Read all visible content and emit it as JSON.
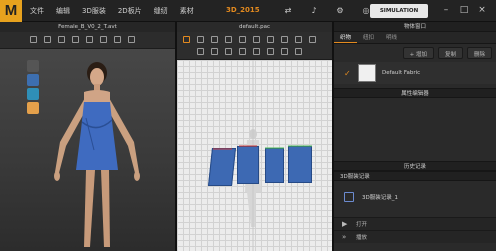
{
  "app": {
    "logo_letter": "M",
    "project_name": "3D_2015"
  },
  "menubar": {
    "items": [
      "文件",
      "编辑",
      "3D服装",
      "2D板片",
      "缝纫",
      "素材"
    ]
  },
  "toolbar_top": {
    "simulation_label": "SIMULATION",
    "icons": [
      "flip-icon",
      "speaker-icon",
      "gear-icon",
      "globe-icon",
      "help-icon"
    ]
  },
  "view3d": {
    "title": "Female_B_V0_2_T.avt",
    "side_buttons": [
      "t-shirt-icon",
      "fabric-icon",
      "pattern-icon",
      "avatar-icon"
    ]
  },
  "view2d": {
    "title": "default.pac"
  },
  "right_panel": {
    "title": "物体窗口",
    "tabs": [
      "织物",
      "纽扣",
      "明线"
    ],
    "add_label": "+ 增加",
    "copy_label": "复制",
    "delete_label": "删除",
    "fabric_name": "Default Fabric",
    "property_section": "属性编辑器",
    "history_section": "历史记录",
    "record_section": "3D服装记录",
    "record_item": "3D服装记录_1",
    "ctrl_play": "打开",
    "ctrl_forward": "播放"
  },
  "colors": {
    "accent": "#e38a1f",
    "fabric_blue": "#3d69b3",
    "panel_bg": "#2a2a2a"
  }
}
